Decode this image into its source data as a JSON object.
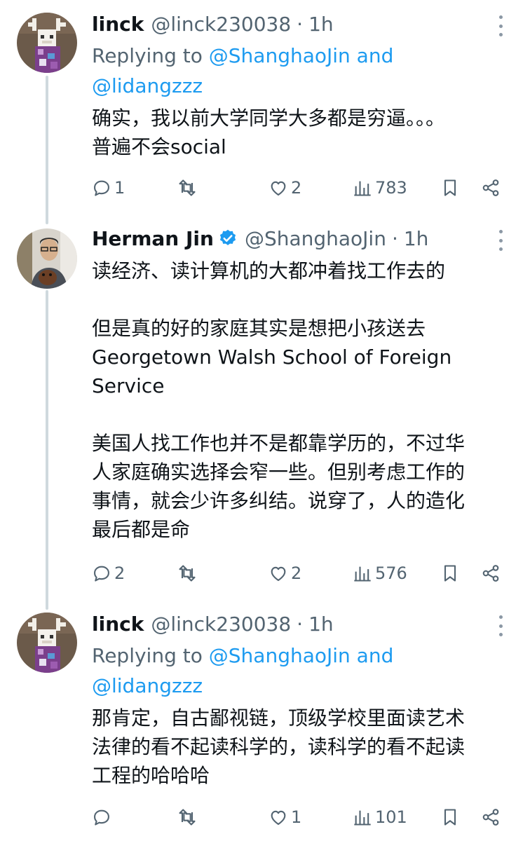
{
  "tweets": [
    {
      "name": "linck",
      "handle": "@linck230038",
      "sep": "·",
      "time": "1h",
      "replying_prefix": "Replying to",
      "replying_mentions_1": "@ShanghaoJin and",
      "replying_mentions_2": "@lidangzzz",
      "lines": [
        "确实，我以前大学同学大多都是穷逼。。。",
        "普遍不会social"
      ],
      "counts": {
        "reply": "1",
        "retweet": "",
        "like": "2",
        "views": "783"
      }
    },
    {
      "name": "Herman Jin",
      "handle": "@ShanghaoJin",
      "sep": "·",
      "time": "1h",
      "verified": true,
      "lines": [
        "读经济、读计算机的大都冲着找工作去的",
        "",
        "但是真的好的家庭其实是想把小孩送去",
        "Georgetown Walsh School of Foreign",
        "Service",
        "",
        "美国人找工作也并不是都靠学历的，不过华",
        "人家庭确实选择会窄一些。但别考虑工作的",
        "事情，就会少许多纠结。说穿了，人的造化",
        "最后都是命"
      ],
      "counts": {
        "reply": "2",
        "retweet": "",
        "like": "2",
        "views": "576"
      }
    },
    {
      "name": "linck",
      "handle": "@linck230038",
      "sep": "·",
      "time": "1h",
      "replying_prefix": "Replying to",
      "replying_mentions_1": "@ShanghaoJin and",
      "replying_mentions_2": "@lidangzzz",
      "lines": [
        "那肯定，自古鄙视链，顶级学校里面读艺术",
        "法律的看不起读科学的，读科学的看不起读",
        "工程的哈哈哈"
      ],
      "counts": {
        "reply": "",
        "retweet": "",
        "like": "1",
        "views": "101"
      }
    }
  ],
  "icons": [
    "reply-icon",
    "retweet-icon",
    "like-icon",
    "views-icon",
    "bookmark-icon",
    "share-icon",
    "more-icon",
    "verified-icon"
  ],
  "colors": {
    "accent": "#1d9bf0",
    "secondary_text": "#536471",
    "thread_line": "#cfd9de"
  }
}
